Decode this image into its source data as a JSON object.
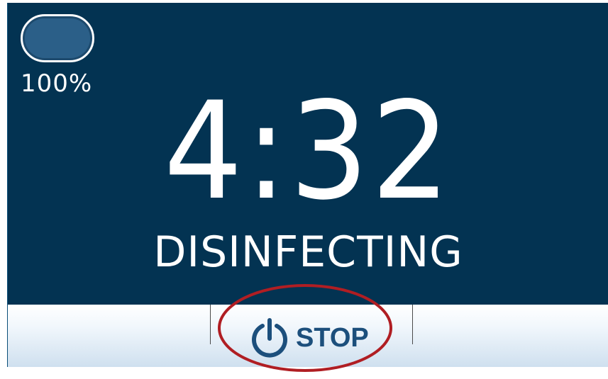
{
  "battery": {
    "level_percent": 100,
    "label": "100%",
    "icon": "battery-icon"
  },
  "timer": {
    "value": "4:32"
  },
  "status": {
    "text": "DISINFECTING"
  },
  "toolbar": {
    "stop_label": "STOP",
    "stop_icon": "power-icon"
  },
  "colors": {
    "display_background": "#033352",
    "text": "#ffffff",
    "button_accent": "#1c4f7c",
    "highlight_ring": "#b01e23"
  }
}
